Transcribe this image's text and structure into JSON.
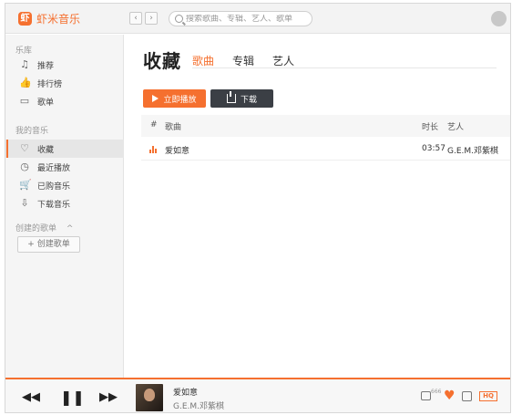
{
  "app": {
    "name": "虾米音乐",
    "logo_glyph": "虾"
  },
  "nav": {
    "back": "‹",
    "forward": "›"
  },
  "search": {
    "placeholder": "搜索歌曲、专辑、艺人、歌单"
  },
  "sidebar": {
    "library_title": "乐库",
    "library_items": [
      {
        "label": "推荐",
        "icon": "♫"
      },
      {
        "label": "排行榜",
        "icon": "👍"
      },
      {
        "label": "歌单",
        "icon": "▭"
      }
    ],
    "my_music_title": "我的音乐",
    "my_music_items": [
      {
        "label": "收藏",
        "icon": "♡",
        "active": true
      },
      {
        "label": "最近播放",
        "icon": "◷"
      },
      {
        "label": "已购音乐",
        "icon": "🛒"
      },
      {
        "label": "下载音乐",
        "icon": "⇩"
      }
    ],
    "created_title": "创建的歌单",
    "created_toggle": "^",
    "create_button": "+ 创建歌单"
  },
  "main": {
    "title": "收藏",
    "tabs": [
      {
        "label": "歌曲",
        "active": true
      },
      {
        "label": "专辑",
        "active": false
      },
      {
        "label": "艺人",
        "active": false
      }
    ],
    "play_button": "立即播放",
    "download_button": "下载",
    "table": {
      "headers": {
        "index": "#",
        "song": "歌曲",
        "duration": "时长",
        "artist": "艺人"
      },
      "rows": [
        {
          "song": "爱如意",
          "duration": "03:57",
          "artist": "G.E.M.邓紫棋",
          "playing": true
        }
      ]
    }
  },
  "player": {
    "prev": "◀◀",
    "pause": "❚❚",
    "next": "▶▶",
    "title": "爱如意",
    "artist": "G.E.M.邓紫棋",
    "comment_count": "666",
    "quality": "HQ"
  },
  "colors": {
    "accent": "#f5702f",
    "dark_button": "#3b3f45"
  }
}
